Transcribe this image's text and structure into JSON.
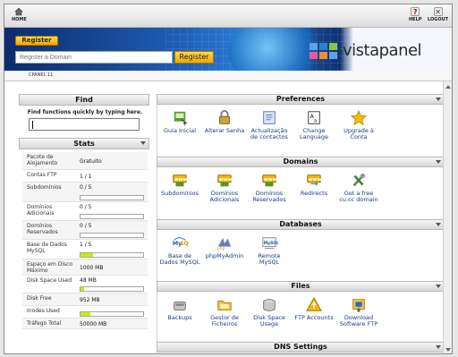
{
  "toolbar": {
    "home": "HOME",
    "help": "HELP",
    "logout": "LOGOUT"
  },
  "register": {
    "tab_label": "Register",
    "placeholder": "Register a Domain",
    "button": "Register"
  },
  "brand": {
    "logo_text": "vistapanel"
  },
  "breadcrumb": "CPANEL 11",
  "find": {
    "title": "Find",
    "hint": "Find functions quickly by typing here.",
    "value": ""
  },
  "stats": {
    "title": "Stats",
    "rows": [
      {
        "label": "Pacote de Alojamento",
        "value": "Gratuito"
      },
      {
        "label": "Contas FTP",
        "value": "1 / 1"
      },
      {
        "label": "Subdomínios",
        "value": "0 / 5",
        "fill": 0.0
      },
      {
        "label": "Domínios Adicionais",
        "value": "0 / 5",
        "fill": 0.0
      },
      {
        "label": "Domínios Reservados",
        "value": "0 / 5",
        "fill": 0.0
      },
      {
        "label": "Base de Dados MySQL",
        "value": "1 / 5",
        "fill": 0.2
      },
      {
        "label": "Espaço em Disco Máximo",
        "value": "1000 MB"
      },
      {
        "label": "Disk Space Used",
        "value": "48 MB",
        "fill": 0.05
      },
      {
        "label": "Disk Free",
        "value": "952 MB"
      },
      {
        "label": "Inodes Used",
        "value": "",
        "fill": 0.15
      },
      {
        "label": "Tráfego Total",
        "value": "50000 MB"
      }
    ]
  },
  "sections": {
    "preferences": {
      "title": "Preferences",
      "items": [
        {
          "label": "Guia Inicial",
          "icon": "guide-icon"
        },
        {
          "label": "Alterar Senha",
          "icon": "lock-icon"
        },
        {
          "label": "Actualização de contactos",
          "icon": "contacts-icon"
        },
        {
          "label": "Change Language",
          "icon": "language-icon"
        },
        {
          "label": "Upgrade à Conta",
          "icon": "star-icon"
        }
      ]
    },
    "domains": {
      "title": "Domains",
      "items": [
        {
          "label": "Subdomínios",
          "icon": "www-icon"
        },
        {
          "label": "Domínios Adicionais",
          "icon": "www-icon"
        },
        {
          "label": "Domínios Reservados",
          "icon": "www-icon"
        },
        {
          "label": "Redirects",
          "icon": "www-redirect-icon"
        },
        {
          "label": "Get a free cu.cc domain",
          "icon": "tools-icon"
        }
      ]
    },
    "databases": {
      "title": "Databases",
      "items": [
        {
          "label": "Base de Dados MySQL",
          "icon": "mysql-icon"
        },
        {
          "label": "phpMyAdmin",
          "icon": "phpmyadmin-icon"
        },
        {
          "label": "Remote MySQL",
          "icon": "remote-mysql-icon"
        }
      ]
    },
    "files": {
      "title": "Files",
      "items": [
        {
          "label": "Backups",
          "icon": "backup-icon"
        },
        {
          "label": "Gestor de Ficheiros",
          "icon": "folder-icon"
        },
        {
          "label": "Disk Space Usage",
          "icon": "disk-icon"
        },
        {
          "label": "FTP Accounts",
          "icon": "ftp-icon"
        },
        {
          "label": "Download Software FTP",
          "icon": "download-icon"
        }
      ]
    },
    "dns": {
      "title": "DNS Settings"
    }
  },
  "colors": {
    "accent_yellow": "#f2a800",
    "bar_fill": "#c8f000",
    "banner_blue": "#1f5fb7",
    "link_blue": "#1a3a8c"
  }
}
